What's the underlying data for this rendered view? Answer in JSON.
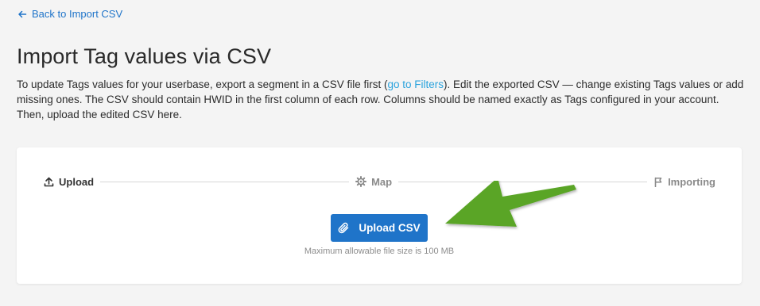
{
  "back_link": {
    "icon": "arrow-left-icon",
    "label": "Back to Import CSV"
  },
  "title": "Import Tag values via CSV",
  "description": {
    "before_link": "To update Tags values for your userbase, export a segment in a CSV file first (",
    "link_label": "go to Filters",
    "after_link": "). Edit the exported CSV — change existing Tags values or add missing ones. The CSV should contain HWID in the first column of each row. Columns should be named exactly as Tags configured in your account. Then, upload the edited CSV here."
  },
  "steps": [
    {
      "label": "Upload",
      "icon": "upload-icon",
      "state": "active"
    },
    {
      "label": "Map",
      "icon": "gear-icon",
      "state": "inactive"
    },
    {
      "label": "Importing",
      "icon": "flag-icon",
      "state": "inactive"
    }
  ],
  "upload_button": {
    "label": "Upload CSV",
    "icon": "paperclip-icon"
  },
  "file_hint": "Maximum allowable file size is 100 MB",
  "colors": {
    "primary": "#1f74c9",
    "link": "#2ba3dd",
    "annotation": "#5aa526"
  }
}
